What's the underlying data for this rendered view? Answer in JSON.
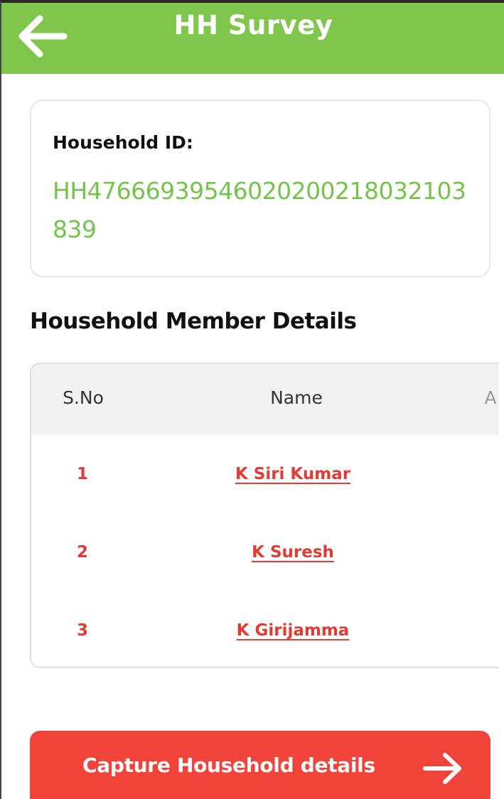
{
  "header": {
    "title": "HH Survey",
    "back_icon": "arrow-left-icon",
    "background_color": "#80c64c"
  },
  "household": {
    "label": "Household ID:",
    "id_value": "HH476669395460202002180321​03839"
  },
  "members": {
    "section_title": "Household Member Details",
    "columns": [
      "S.No",
      "Name",
      "A"
    ],
    "rows": [
      {
        "sno": "1",
        "name": "K Siri Kumar"
      },
      {
        "sno": "2",
        "name": "K Suresh"
      },
      {
        "sno": "3",
        "name": "K Girijamma"
      }
    ],
    "link_color": "#e33b33"
  },
  "action": {
    "label": "Capture Household details",
    "icon": "arrow-right-icon",
    "background_color": "#f0443a"
  }
}
